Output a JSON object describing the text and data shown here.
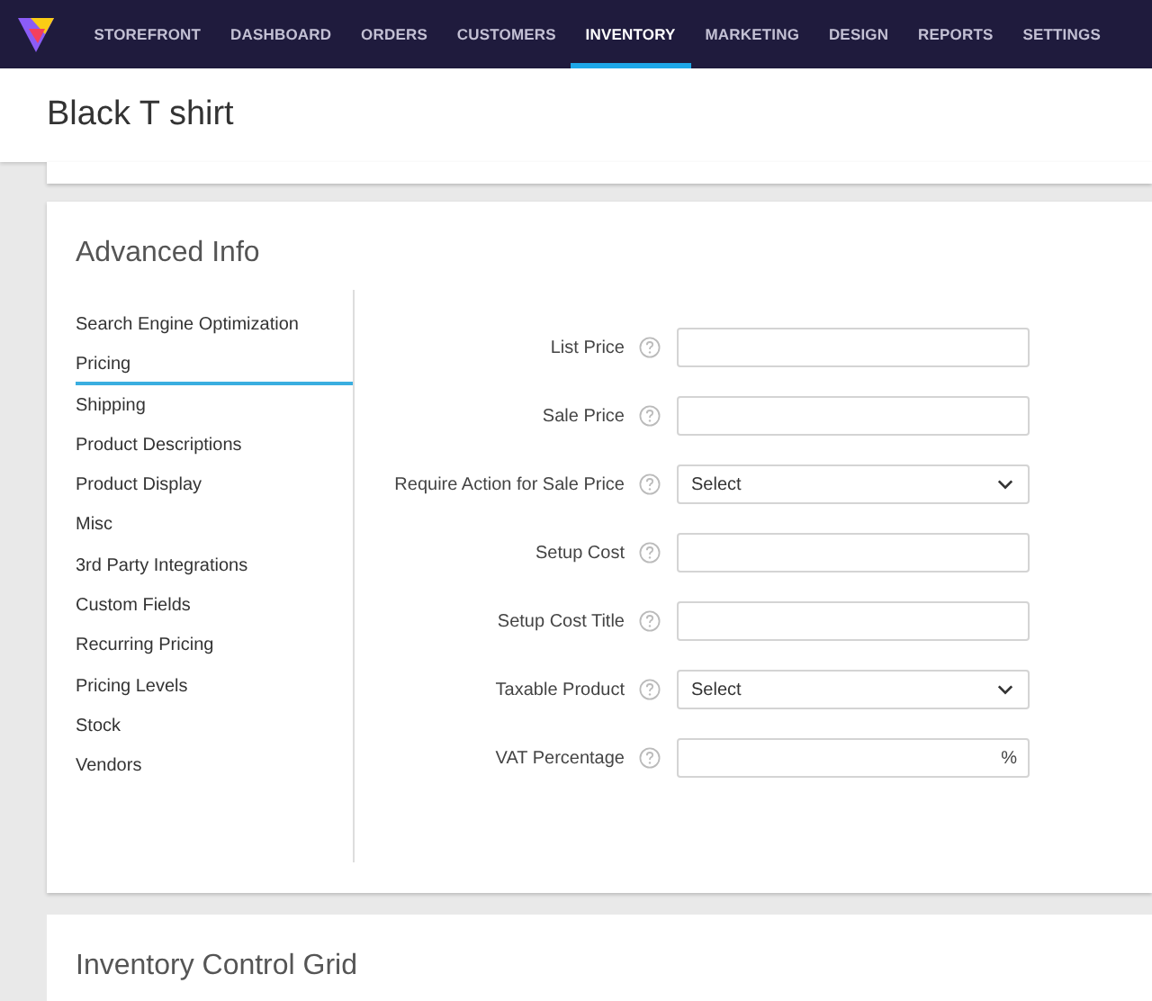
{
  "nav": {
    "items": [
      {
        "label": "STOREFRONT",
        "selected": false
      },
      {
        "label": "DASHBOARD",
        "selected": false
      },
      {
        "label": "ORDERS",
        "selected": false
      },
      {
        "label": "CUSTOMERS",
        "selected": false
      },
      {
        "label": "INVENTORY",
        "selected": true
      },
      {
        "label": "MARKETING",
        "selected": false
      },
      {
        "label": "DESIGN",
        "selected": false
      },
      {
        "label": "REPORTS",
        "selected": false
      },
      {
        "label": "SETTINGS",
        "selected": false
      }
    ]
  },
  "page_title": "Black T shirt",
  "advanced_info": {
    "title": "Advanced Info",
    "sidebar": {
      "items": [
        {
          "label": "Search Engine Optimization",
          "selected": false
        },
        {
          "label": "Pricing",
          "selected": true
        },
        {
          "label": "Shipping",
          "selected": false
        },
        {
          "label": "Product Descriptions",
          "selected": false
        },
        {
          "label": "Product Display",
          "selected": false
        },
        {
          "label": "Misc",
          "selected": false
        },
        {
          "label": "3rd Party Integrations",
          "selected": false
        },
        {
          "label": "Custom Fields",
          "selected": false
        },
        {
          "label": "Recurring Pricing",
          "selected": false
        },
        {
          "label": "Pricing Levels",
          "selected": false
        },
        {
          "label": "Stock",
          "selected": false
        },
        {
          "label": "Vendors",
          "selected": false
        }
      ]
    },
    "fields": [
      {
        "label": "List Price",
        "kind": "text"
      },
      {
        "label": "Sale Price",
        "kind": "text"
      },
      {
        "label": "Require Action for Sale Price",
        "kind": "select",
        "value": "Select"
      },
      {
        "label": "Setup Cost",
        "kind": "text"
      },
      {
        "label": "Setup Cost Title",
        "kind": "text"
      },
      {
        "label": "Taxable Product",
        "kind": "select",
        "value": "Select"
      },
      {
        "label": "VAT Percentage",
        "kind": "suffix",
        "suffix": "%"
      }
    ]
  },
  "next_section": {
    "title": "Inventory Control Grid"
  }
}
